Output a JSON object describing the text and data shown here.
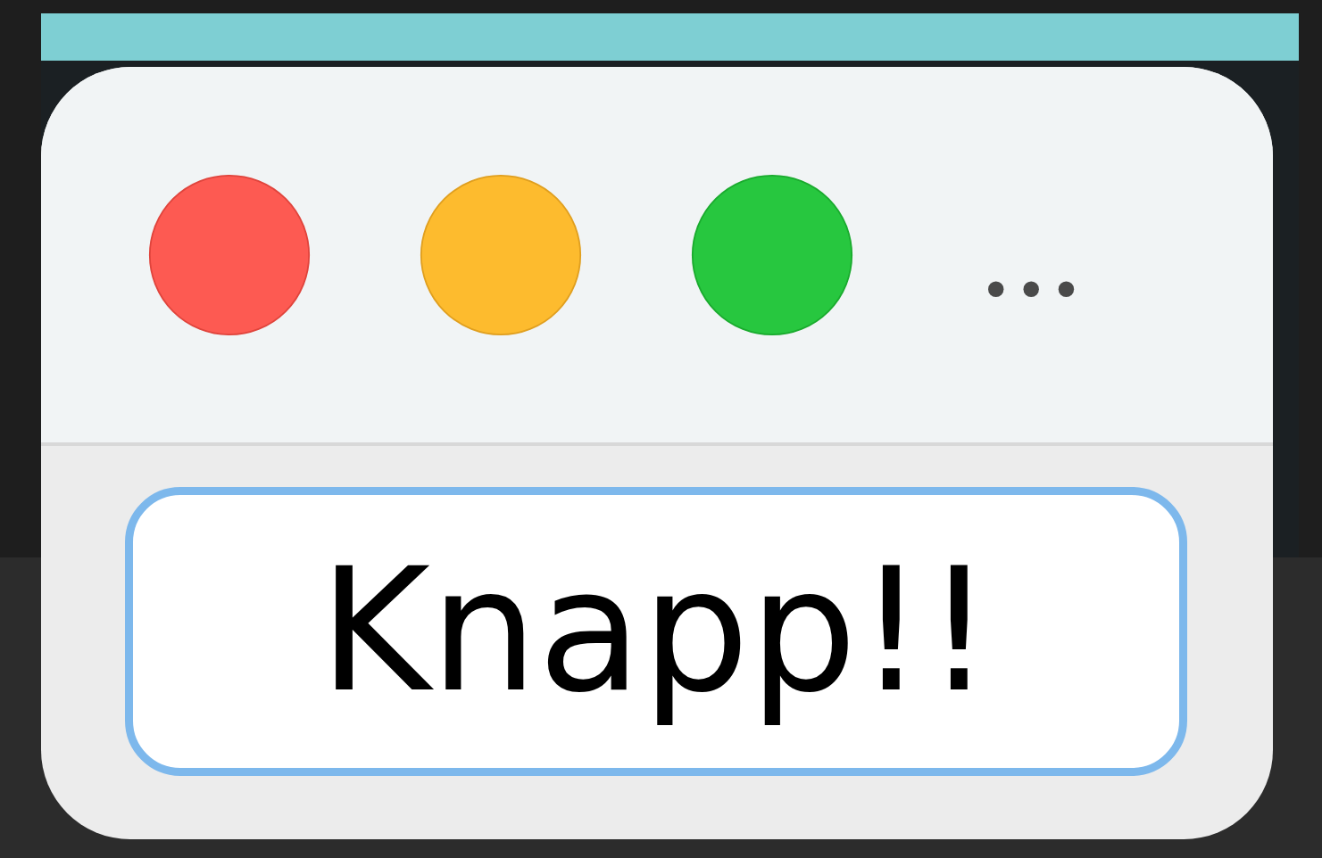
{
  "window": {
    "more_label": "•••"
  },
  "button": {
    "label": "Knapp!!",
    "focused": true
  }
}
